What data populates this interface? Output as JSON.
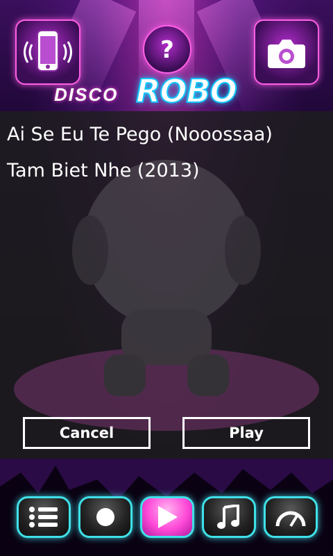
{
  "header": {
    "phone_button_icon": "phone-vibrate-icon",
    "help_button_icon": "question-mark-icon",
    "camera_button_icon": "camera-icon",
    "logo_small": "DISCO",
    "logo_big": "ROBO"
  },
  "songs": [
    {
      "title": "Ai Se Eu Te Pego (Nooossaa)"
    },
    {
      "title": "Tam Biet Nhe (2013)"
    }
  ],
  "dialog": {
    "cancel_label": "Cancel",
    "play_label": "Play"
  },
  "toolbar": {
    "items": [
      {
        "icon": "list-icon",
        "active": false
      },
      {
        "icon": "record-icon",
        "active": false
      },
      {
        "icon": "play-icon",
        "active": true
      },
      {
        "icon": "music-note-icon",
        "active": false
      },
      {
        "icon": "speedometer-icon",
        "active": false
      }
    ]
  },
  "colors": {
    "accent_pink": "#ff5fe6",
    "accent_cyan": "#3fe1e8",
    "overlay": "#1e1e1e",
    "text": "#ffffff"
  }
}
